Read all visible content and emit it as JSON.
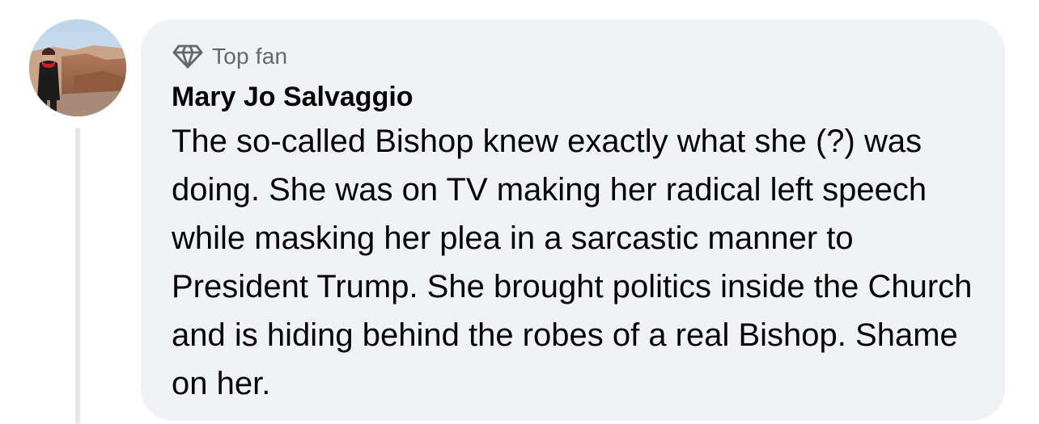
{
  "comment": {
    "badge": {
      "icon": "diamond-icon",
      "label": "Top fan"
    },
    "author": "Mary Jo Salvaggio",
    "text": "The so-called Bishop knew exactly what she (?) was doing. She was on TV making her radical left speech while masking her plea in a sarcastic manner to President Trump. She brought politics inside the Church and is hiding behind the robes of a real Bishop. Shame on her."
  },
  "colors": {
    "bubble_background": "#f0f2f5",
    "primary_text": "#050505",
    "secondary_text": "#65676b",
    "thread_line": "#e4e6eb"
  }
}
